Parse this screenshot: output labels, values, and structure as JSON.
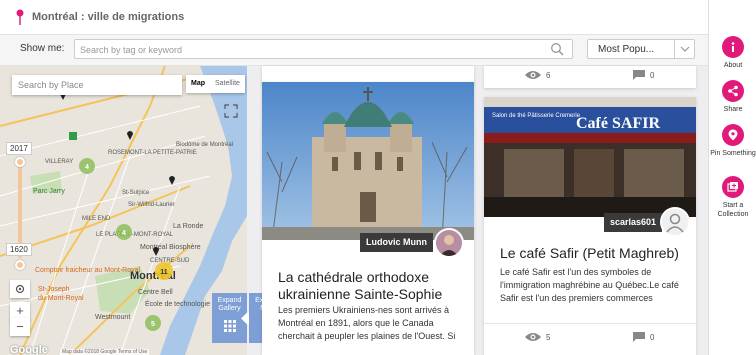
{
  "site": {
    "title": "Montréal : ville de migrations"
  },
  "filter": {
    "show_me_label": "Show me:",
    "search_placeholder": "Search by tag or keyword",
    "sort_value": "Most Popu..."
  },
  "sidebar": {
    "accent_color": "#e0197a",
    "items": [
      {
        "label": "About",
        "icon": "info-icon"
      },
      {
        "label": "Share",
        "icon": "share-icon"
      },
      {
        "label": "Pin Something",
        "icon": "pin-icon"
      },
      {
        "label": "Start a Collection",
        "icon": "collection-icon"
      }
    ]
  },
  "map": {
    "search_placeholder": "Search by Place",
    "type_map": "Map",
    "type_satellite": "Satellite",
    "year_max": "2017",
    "year_min": "1620",
    "labels": {
      "biodome": "Biodôme de Montréal",
      "villeray": "VILLERAY",
      "parc_jarry": "Parc Jarry",
      "rosemont": "ROSEMONT-LA PETITE-PATRIE",
      "st_sulpice": "St-Sulpice",
      "sir_wilfrid": "Sir-Wilfrid-Laurier",
      "mile_end": "MILE END",
      "la_ronde": "La Ronde",
      "plateau": "LE PLATEAU-MONT-ROYAL",
      "biosphere": "Montréal Biosphère",
      "centre_sud": "CENTRE-SUD",
      "comptoir": "Comptoir fraicheur au Mont-Royal",
      "joseph": "St-Joseph",
      "mont_royal": "du Mont-Royal",
      "montreal": "Montréal",
      "centre_bell": "Centre Bell",
      "ecole": "École de technologie supérieure",
      "westmount": "Westmount"
    },
    "clusters": [
      "4",
      "4",
      "11",
      "5"
    ],
    "google": "Google",
    "attribution": "Map data ©2018 Google   Terms of Use",
    "expand_gallery": "Expand Gallery",
    "expand_map": "Expand Map"
  },
  "cards": [
    {
      "id": "top-left-partial",
      "views": "6",
      "comments": "0"
    },
    {
      "id": "cathedrale",
      "author": "Ludovic Munn",
      "title": "La cathédrale orthodoxe ukrainienne Sainte-Sophie",
      "text": "Les premiers Ukrainiens-nes sont arrivés à Montréal en 1891, alors que le Canada cherchait à peupler les plaines de l'Ouest. Si"
    },
    {
      "id": "cafe-safir",
      "author": "scarlas601",
      "title": "Le café Safir (Petit Maghreb)",
      "text": "Le café Safir est l'un des symboles de l'immigration maghrébine au Québec.Le café Safir est l'un des premiers commerces",
      "views": "5",
      "comments": "0",
      "photo_sign": "Café SAFIR",
      "photo_sub": "Salon de thé Pâtisserie Cremerie"
    }
  ]
}
